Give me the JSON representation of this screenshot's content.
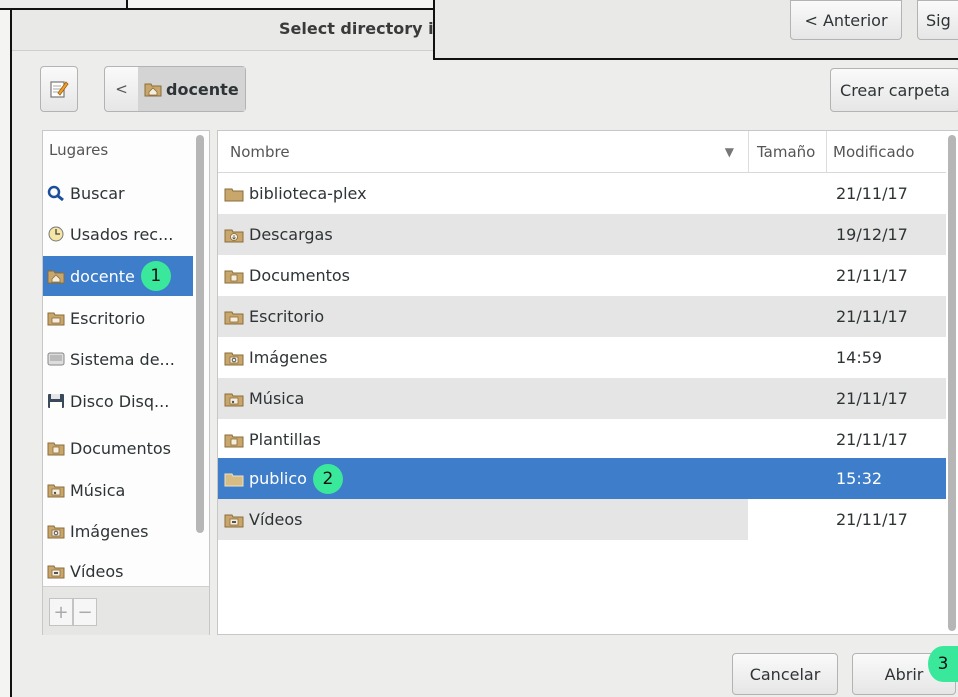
{
  "window": {
    "title": "Select directory in"
  },
  "overlay": {
    "prev_label": "< Anterior",
    "next_label": "Sig"
  },
  "toolbar": {
    "location_icon": "edit-pencil-icon",
    "back_label": "<",
    "current_folder": "docente",
    "new_folder_label": "Crear carpeta"
  },
  "sidebar": {
    "header": "Lugares",
    "items": [
      {
        "label": "Buscar",
        "icon": "search-icon"
      },
      {
        "label": "Usados rec...",
        "icon": "clock-icon"
      },
      {
        "label": "docente",
        "icon": "home-folder-icon",
        "selected": true,
        "badge": "1"
      },
      {
        "label": "Escritorio",
        "icon": "desktop-folder-icon"
      },
      {
        "label": "Sistema de...",
        "icon": "drive-icon"
      },
      {
        "label": "Disco Disq...",
        "icon": "floppy-icon"
      },
      {
        "label": "Documentos",
        "icon": "documents-folder-icon"
      },
      {
        "label": "Música",
        "icon": "music-folder-icon"
      },
      {
        "label": "Imágenes",
        "icon": "pictures-folder-icon"
      },
      {
        "label": "Vídeos",
        "icon": "videos-folder-icon"
      }
    ],
    "add_label": "+",
    "remove_label": "−"
  },
  "filelist": {
    "columns": {
      "name": "Nombre",
      "size": "Tamaño",
      "modified": "Modificado"
    },
    "rows": [
      {
        "name": "biblioteca-plex",
        "modified": "21/11/17",
        "icon": "folder-icon"
      },
      {
        "name": "Descargas",
        "modified": "19/12/17",
        "icon": "downloads-folder-icon"
      },
      {
        "name": "Documentos",
        "modified": "21/11/17",
        "icon": "documents-folder-icon"
      },
      {
        "name": "Escritorio",
        "modified": "21/11/17",
        "icon": "desktop-folder-icon"
      },
      {
        "name": "Imágenes",
        "modified": "14:59",
        "icon": "pictures-folder-icon"
      },
      {
        "name": "Música",
        "modified": "21/11/17",
        "icon": "music-folder-icon"
      },
      {
        "name": "Plantillas",
        "modified": "21/11/17",
        "icon": "templates-folder-icon"
      },
      {
        "name": "publico",
        "modified": "15:32",
        "icon": "folder-icon",
        "selected": true,
        "badge": "2"
      },
      {
        "name": "Vídeos",
        "modified": "21/11/17",
        "icon": "videos-folder-icon"
      }
    ]
  },
  "actions": {
    "cancel_label": "Cancelar",
    "open_label": "Abrir",
    "open_badge": "3"
  },
  "colors": {
    "selection": "#3d7dca",
    "badge": "#3ae89b"
  }
}
